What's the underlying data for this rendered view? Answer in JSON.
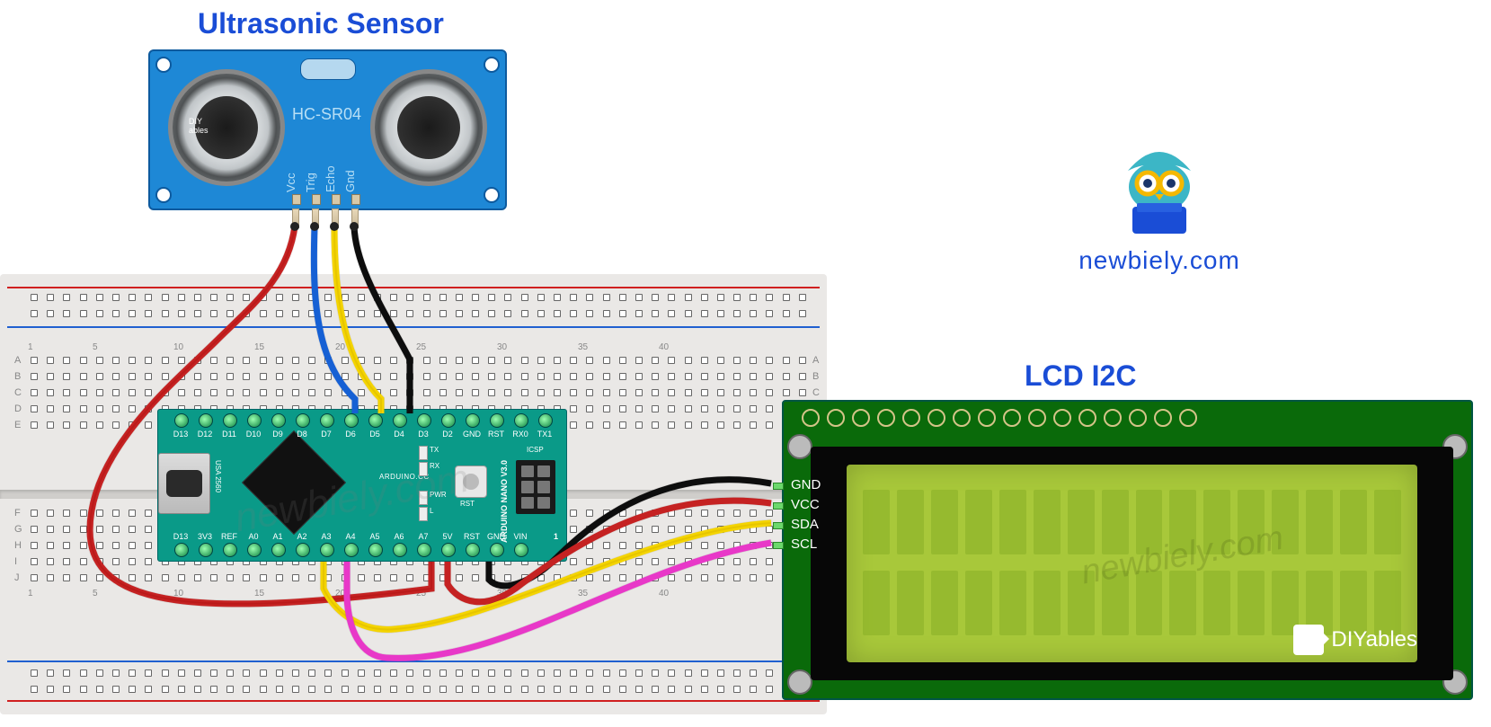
{
  "titles": {
    "ultrasonic": "Ultrasonic Sensor",
    "lcd": "LCD I2C"
  },
  "logo_text": "newbiely.com",
  "watermark": "newbiely.com",
  "ultrasonic": {
    "model": "HC-SR04",
    "pins": [
      "Vcc",
      "Trig",
      "Echo",
      "Gnd"
    ],
    "tx_logo": "DIYables"
  },
  "nano": {
    "board_name": "ARDUINO NANO V3.0",
    "mfr": "ARDUINO.CC",
    "usa_mark": "USA 2560",
    "reset_label": "RST",
    "icsp_label": "ICSP",
    "row_1": "1",
    "top_pins": [
      "D13",
      "D12",
      "D11",
      "D10",
      "D9",
      "D8",
      "D7",
      "D6",
      "D5",
      "D4",
      "D3",
      "D2",
      "GND",
      "RST",
      "RX0",
      "TX1"
    ],
    "bottom_pins": [
      "D13",
      "3V3",
      "REF",
      "A0",
      "A1",
      "A2",
      "A3",
      "A4",
      "A5",
      "A6",
      "A7",
      "5V",
      "RST",
      "GND",
      "VIN"
    ],
    "leds": [
      "TX",
      "RX",
      "PWR",
      "L"
    ]
  },
  "lcd": {
    "i2c_pins": [
      "GND",
      "VCC",
      "SDA",
      "SCL"
    ],
    "brand": "DIYables"
  },
  "breadboard": {
    "rows_top": [
      "A",
      "B",
      "C",
      "D",
      "E"
    ],
    "rows_bot": [
      "F",
      "G",
      "H",
      "I",
      "J"
    ],
    "col_marks": [
      "1",
      "5",
      "10",
      "15",
      "20",
      "25",
      "30",
      "35",
      "40"
    ]
  },
  "wires": {
    "us_vcc": {
      "from": "HC-SR04 Vcc",
      "to": "Nano 5V",
      "color": "#c52020"
    },
    "us_trig": {
      "from": "HC-SR04 Trig",
      "to": "Nano D3",
      "color": "#1860d4"
    },
    "us_echo": {
      "from": "HC-SR04 Echo",
      "to": "Nano D2",
      "color": "#f4d400"
    },
    "us_gnd": {
      "from": "HC-SR04 Gnd",
      "to": "Nano GND (top)",
      "color": "#111"
    },
    "lcd_gnd": {
      "from": "LCD GND",
      "to": "Nano GND (bottom)",
      "color": "#111"
    },
    "lcd_vcc": {
      "from": "LCD VCC",
      "to": "Nano 5V",
      "color": "#c52020"
    },
    "lcd_sda": {
      "from": "LCD SDA",
      "to": "Nano A4",
      "color": "#f4d400"
    },
    "lcd_scl": {
      "from": "LCD SCL",
      "to": "Nano A5",
      "color": "#e838c8"
    }
  }
}
